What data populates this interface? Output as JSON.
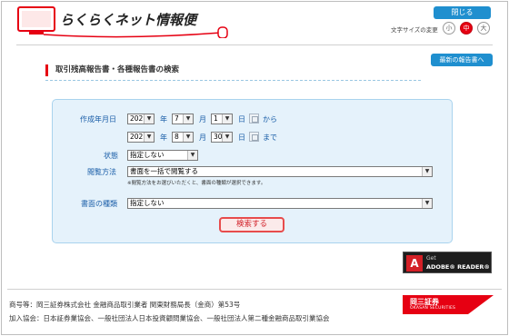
{
  "header": {
    "logo_text": "らくらくネット情報便",
    "close_label": "閉じる",
    "font_size_label": "文字サイズの変更",
    "font_sizes": [
      "小",
      "中",
      "大"
    ],
    "latest_report_label": "最新の報告書へ"
  },
  "section": {
    "title": "取引残高報告書・各種報告書の検索"
  },
  "form": {
    "created_label": "作成年月日",
    "from": {
      "year": "2021",
      "month": "7",
      "day": "1"
    },
    "to": {
      "year": "2021",
      "month": "8",
      "day": "30"
    },
    "unit_year": "年",
    "unit_month": "月",
    "unit_day": "日",
    "from_suffix": "から",
    "to_suffix": "まで",
    "status_label": "状態",
    "status_value": "指定しない",
    "method_label": "閲覧方法",
    "method_value": "書面を一括で閲覧する",
    "method_note": "※閲覧方法をお選びいただくと、書面の種類が選択できます。",
    "doc_type_label": "書面の種類",
    "doc_type_value": "指定しない",
    "search_label": "検索する"
  },
  "adobe": {
    "get": "Get",
    "name": "ADOBE® READER®",
    "mark": "A"
  },
  "footer": {
    "line1": "商号等：岡三証券株式会社 金融商品取引業者 関東財務局長（金商）第53号",
    "line2": "加入協会：日本証券業協会、一般社団法人日本投資顧問業協会、一般社団法人第二種金融商品取引業協会"
  },
  "brand": {
    "name_jp": "岡三証券",
    "name_en": "OKASAN SECURITIES",
    "accent": "#e60012",
    "blue": "#1f8fcf"
  }
}
